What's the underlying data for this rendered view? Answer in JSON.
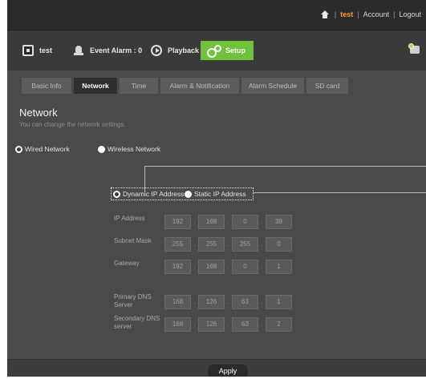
{
  "top_links": {
    "home_icon": "home-icon",
    "user": "test",
    "account": "Account",
    "logout": "Logout"
  },
  "nav": {
    "live": "test",
    "event_alarm": "Event Alarm : 0",
    "playback": "Playback",
    "setup": "Setup"
  },
  "tabs": [
    "Basic Info",
    "Network",
    "Time",
    "Alarm & Notification",
    "Alarm Schedule",
    "SD card"
  ],
  "active_tab": "Network",
  "section": {
    "title": "Network",
    "description": "You can change the network settings."
  },
  "network_type": {
    "wired": "Wired Network",
    "wireless": "Wireless Network",
    "selected": "Wired Network"
  },
  "ip_mode": {
    "dynamic": "Dynamic IP Address",
    "static": "Static IP Address",
    "selected": "Dynamic IP Address"
  },
  "fields": [
    {
      "label": "IP Address",
      "octets": [
        "192",
        "168",
        "0",
        "39"
      ]
    },
    {
      "label": "Subnet Mask",
      "octets": [
        "255",
        "255",
        "255",
        "0"
      ]
    },
    {
      "label": "Gateway",
      "octets": [
        "192",
        "168",
        "0",
        "1"
      ]
    },
    {
      "label": "Primary DNS Server",
      "octets": [
        "168",
        "126",
        "63",
        "1"
      ]
    },
    {
      "label": "Secondary DNS server",
      "octets": [
        "168",
        "126",
        "63",
        "2"
      ]
    }
  ],
  "apply_label": "Apply",
  "colors": {
    "setup_active": "#6fc23a",
    "user_link": "#ff9933",
    "background": "#4a4a4a"
  }
}
